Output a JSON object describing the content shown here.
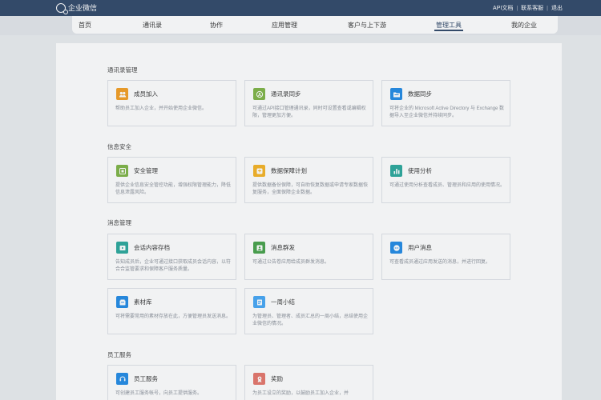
{
  "topbar": {
    "logo_text": "企业微信",
    "links": [
      "API文档",
      "联系客服",
      "退出"
    ]
  },
  "nav": {
    "items": [
      "首页",
      "通讯录",
      "协作",
      "应用管理",
      "客户与上下游",
      "管理工具",
      "我的企业"
    ],
    "active": "管理工具"
  },
  "sections": [
    {
      "title": "通讯录管理",
      "cards": [
        {
          "icon": "people-icon",
          "color": "#f39c1f",
          "title": "成员加入",
          "desc": "帮助员工加入企业，并开始使用企业微信。"
        },
        {
          "icon": "sync-icon",
          "color": "#7cb342",
          "title": "通讯录同步",
          "desc": "可通过API接口管理通讯录，同时可设置查看或编辑权限，管理更加方便。"
        },
        {
          "icon": "folder-icon",
          "color": "#1e88e5",
          "title": "数据同步",
          "desc": "可将企业的 Microsoft Active Directory 与 Exchange 数据导入至企业微信并持续同步。"
        }
      ]
    },
    {
      "title": "信息安全",
      "cards": [
        {
          "icon": "shield-icon",
          "color": "#7cb342",
          "title": "安全管理",
          "desc": "提供企业信息安全管控功能，增强权限管理能力，降低信息泄露风险。"
        },
        {
          "icon": "backup-icon",
          "color": "#f5b120",
          "title": "数据保障计划",
          "desc": "提供数据备份保障，可自助恢复数据或申请专家数据恢复服务，全面保障企业数据。"
        },
        {
          "icon": "chart-icon",
          "color": "#26a69a",
          "title": "使用分析",
          "desc": "可通过使用分析查看成员、管理员和应用的使用情况。"
        }
      ]
    },
    {
      "title": "消息管理",
      "cards": [
        {
          "icon": "archive-icon",
          "color": "#26a69a",
          "title": "会话内容存档",
          "desc": "告知成员后，企业可通过接口获取成员会话内容，以符合合监管要求和保障客户服务质量。"
        },
        {
          "icon": "broadcast-icon",
          "color": "#43a047",
          "title": "消息群发",
          "desc": "可通过公告卷应用给成员群发消息。"
        },
        {
          "icon": "message-icon",
          "color": "#1e88e5",
          "title": "用户消息",
          "desc": "可查看成员通过应用发送的消息，并进行回复。"
        },
        {
          "icon": "library-icon",
          "color": "#1e88e5",
          "title": "素材库",
          "desc": "可将需要常用的素材存放在此，方便管理员发送消息。"
        },
        {
          "icon": "report-icon",
          "color": "#42a5f5",
          "title": "一周小结",
          "desc": "为管理员、管理者、成员汇总的一周小结，总结使用企业微信的情况。"
        }
      ]
    },
    {
      "title": "员工服务",
      "cards": [
        {
          "icon": "service-icon",
          "color": "#1e88e5",
          "title": "员工服务",
          "desc": "可创建员工服务帐号，向员工提供服务。"
        },
        {
          "icon": "reward-icon",
          "color": "#e57368",
          "title": "奖励",
          "desc": "为员工设立的奖励，以鼓励员工加入企业，并"
        }
      ]
    }
  ]
}
